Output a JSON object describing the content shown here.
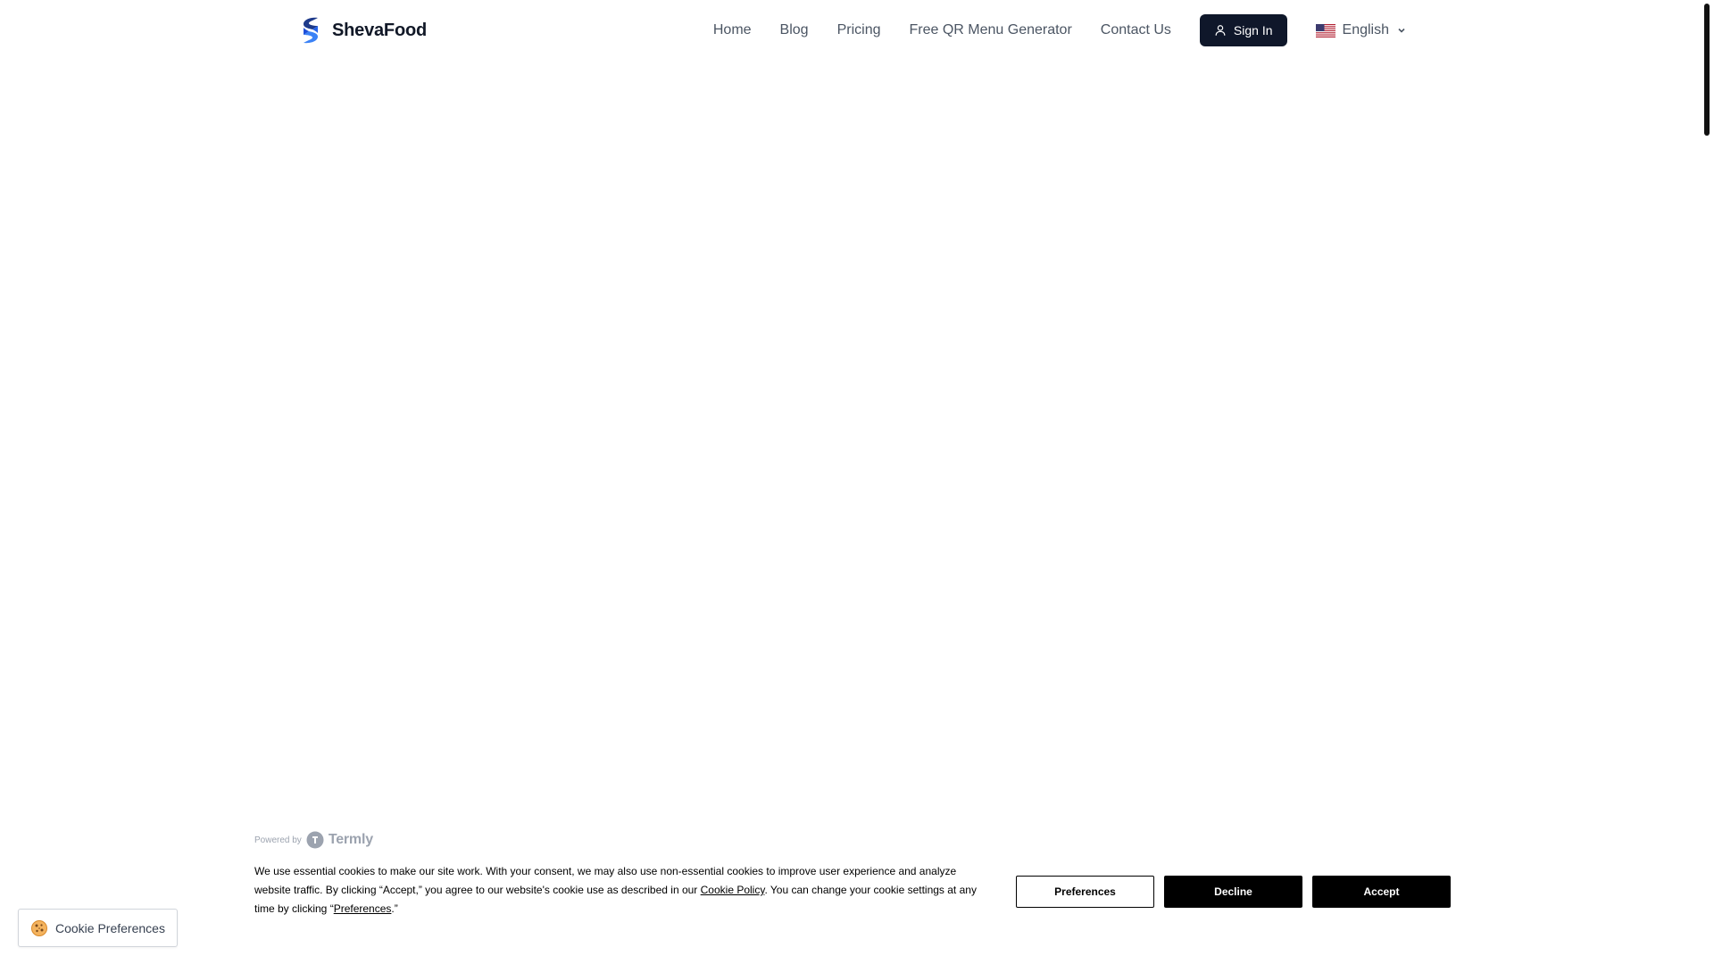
{
  "brand": {
    "name": "ShevaFood",
    "logo_icon": "s-swoosh-logo-icon",
    "logo_colors": [
      "#1e3a8a",
      "#3b82f6"
    ]
  },
  "nav": {
    "items": [
      {
        "label": "Home"
      },
      {
        "label": "Blog"
      },
      {
        "label": "Pricing"
      },
      {
        "label": "Free QR Menu Generator"
      },
      {
        "label": "Contact Us"
      }
    ],
    "sign_in": {
      "label": "Sign In",
      "icon": "user-icon",
      "bg_color": "#0f172a"
    },
    "language": {
      "label": "English",
      "flag_icon": "us-flag-icon",
      "chevron_icon": "chevron-down-icon"
    }
  },
  "cookie_banner": {
    "powered_by": "Powered by",
    "provider": "Termly",
    "text_part1": "We use essential cookies to make our site work. With your consent, we may also use non-essential cookies to improve user experience and analyze website traffic. By clicking “Accept,” you agree to our website's cookie use as described in our ",
    "cookie_policy_link": "Cookie Policy",
    "text_part2": ". You can change your cookie settings at any time by clicking “",
    "preferences_link": "Preferences",
    "text_part3": ".”",
    "buttons": {
      "preferences": "Preferences",
      "decline": "Decline",
      "accept": "Accept"
    }
  },
  "cookie_preferences_button": {
    "label": "Cookie Preferences",
    "icon": "cookie-icon"
  }
}
